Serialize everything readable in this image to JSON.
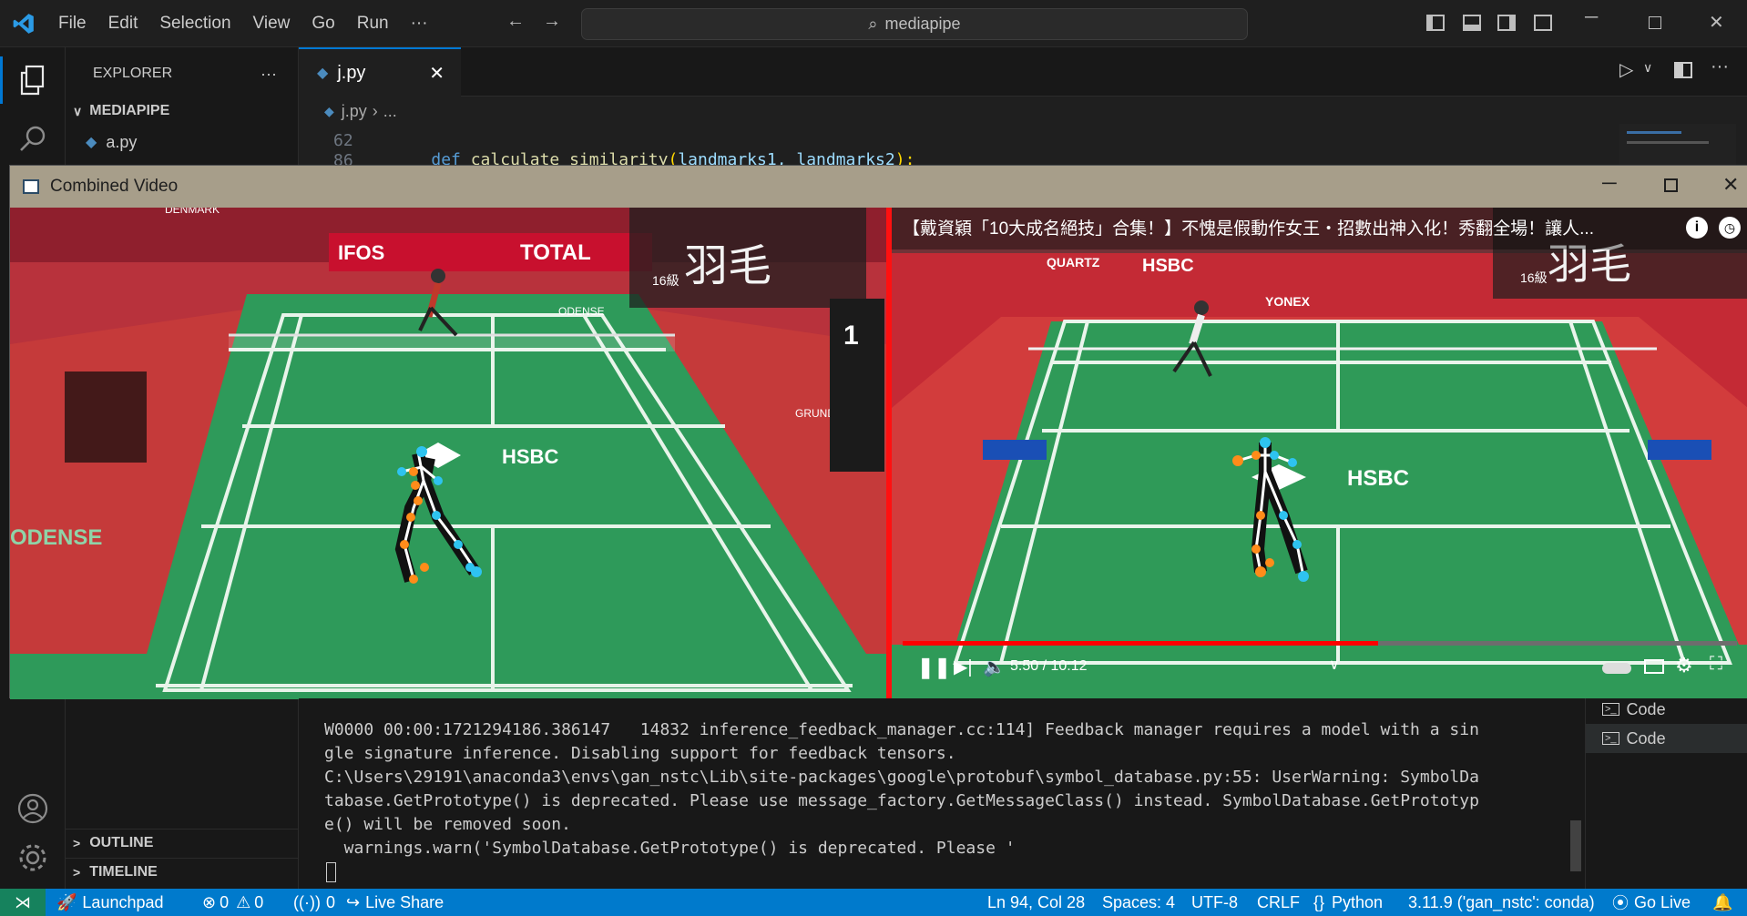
{
  "titlebar": {
    "menu": [
      "File",
      "Edit",
      "Selection",
      "View",
      "Go",
      "Run",
      "···"
    ],
    "search_text": "mediapipe"
  },
  "sidebar": {
    "title": "EXPLORER",
    "more": "···",
    "folder": "MEDIAPIPE",
    "file": "a.py",
    "outline": "OUTLINE",
    "timeline": "TIMELINE"
  },
  "editor": {
    "tab_label": "j.py",
    "breadcrumb_file": "j.py",
    "breadcrumb_rest": "...",
    "line_numbers": [
      "62",
      "86"
    ],
    "code_keyword": "def",
    "code_func": "calculate_similarity",
    "code_params": "landmarks1, landmarks2",
    "code_open": "(",
    "code_comma_close": "):"
  },
  "video_window": {
    "title": "Combined Video",
    "right_caption": "【戴資穎「10大成名絕技」合集！】不愧是假動作女王・招數出神入化！秀翻全場！讓人...",
    "time": "5:50 / 10:12",
    "progress": 0.57,
    "left_banner_text": "HSBC",
    "left_total_text": "TOTAL",
    "left_odense_text": "ODENSE",
    "left_watermark": "羽毛",
    "left_badge": "16級",
    "right_hsbc_text": "HSBC",
    "right_quartz_text": "QUARTZ",
    "right_court_hsbc": "HSBC",
    "right_yonex": "YONEX",
    "right_watermark": "羽毛",
    "right_badge": "16級",
    "left_sign_1": "1",
    "left_sign_denmark": "DENMARK",
    "left_sign_ifos": "IFOS",
    "left_odense_net": "ODENSE",
    "left_grundfos": "GRUNDFOS"
  },
  "terminal": {
    "lines": [
      "W0000 00:00:1721294186.386147   14832 inference_feedback_manager.cc:114] Feedback manager requires a model with a sin",
      "gle signature inference. Disabling support for feedback tensors.",
      "C:\\Users\\29191\\anaconda3\\envs\\gan_nstc\\Lib\\site-packages\\google\\protobuf\\symbol_database.py:55: UserWarning: SymbolDa",
      "tabase.GetPrototype() is deprecated. Please use message_factory.GetMessageClass() instead. SymbolDatabase.GetPrototyp",
      "e() will be removed soon.",
      "  warnings.warn('SymbolDatabase.GetPrototype() is deprecated. Please '"
    ],
    "list": [
      "Code",
      "Code"
    ]
  },
  "statusbar": {
    "remote": "⋊",
    "launchpad": "Launchpad",
    "errors": "0",
    "warnings": "0",
    "ports": "0",
    "liveshare": "Live Share",
    "position": "Ln 94, Col 28",
    "spaces": "Spaces: 4",
    "encoding": "UTF-8",
    "eol": "CRLF",
    "language": "Python",
    "interpreter": "3.11.9 ('gan_nstc': conda)",
    "golive": "Go Live"
  },
  "colors": {
    "accent": "#007acc",
    "titlebar_window": "#a79e8a",
    "court_green": "#2e9a5a",
    "red_divider": "#ff1010",
    "pose_orange": "#ff8c1a",
    "pose_cyan": "#2ec3f0"
  }
}
